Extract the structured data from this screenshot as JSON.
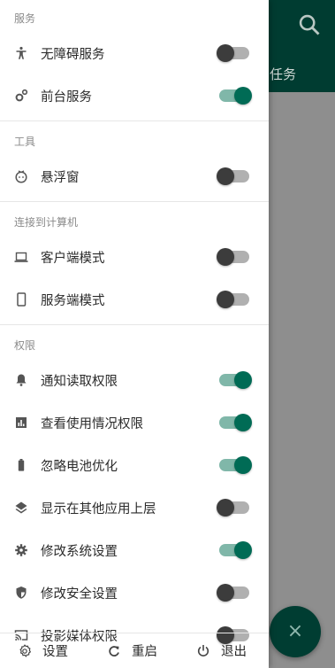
{
  "background": {
    "tab_label": "任务",
    "search_icon": "search-icon",
    "fab_icon": "×"
  },
  "drawer": {
    "sections": [
      {
        "header": "服务",
        "items": [
          {
            "label": "无障碍服务",
            "icon": "accessibility-icon",
            "enabled": false
          },
          {
            "label": "前台服务",
            "icon": "gears-icon",
            "enabled": true
          }
        ]
      },
      {
        "header": "工具",
        "items": [
          {
            "label": "悬浮窗",
            "icon": "floating-window-icon",
            "enabled": false
          }
        ]
      },
      {
        "header": "连接到计算机",
        "items": [
          {
            "label": "客户端模式",
            "icon": "laptop-icon",
            "enabled": false
          },
          {
            "label": "服务端模式",
            "icon": "phone-icon",
            "enabled": false
          }
        ]
      },
      {
        "header": "权限",
        "items": [
          {
            "label": "通知读取权限",
            "icon": "bell-icon",
            "enabled": true
          },
          {
            "label": "查看使用情况权限",
            "icon": "bar-chart-icon",
            "enabled": true
          },
          {
            "label": "忽略电池优化",
            "icon": "battery-icon",
            "enabled": true
          },
          {
            "label": "显示在其他应用上层",
            "icon": "layers-icon",
            "enabled": false
          },
          {
            "label": "修改系统设置",
            "icon": "gear-icon",
            "enabled": true
          },
          {
            "label": "修改安全设置",
            "icon": "shield-icon",
            "enabled": false
          },
          {
            "label": "投影媒体权限",
            "icon": "cast-icon",
            "enabled": false
          }
        ]
      }
    ],
    "footer": {
      "settings_label": "设置",
      "restart_label": "重启",
      "exit_label": "退出"
    }
  },
  "colors": {
    "accent": "#006b55",
    "accent_track": "#80b7a9",
    "toolbar": "#003c31"
  }
}
